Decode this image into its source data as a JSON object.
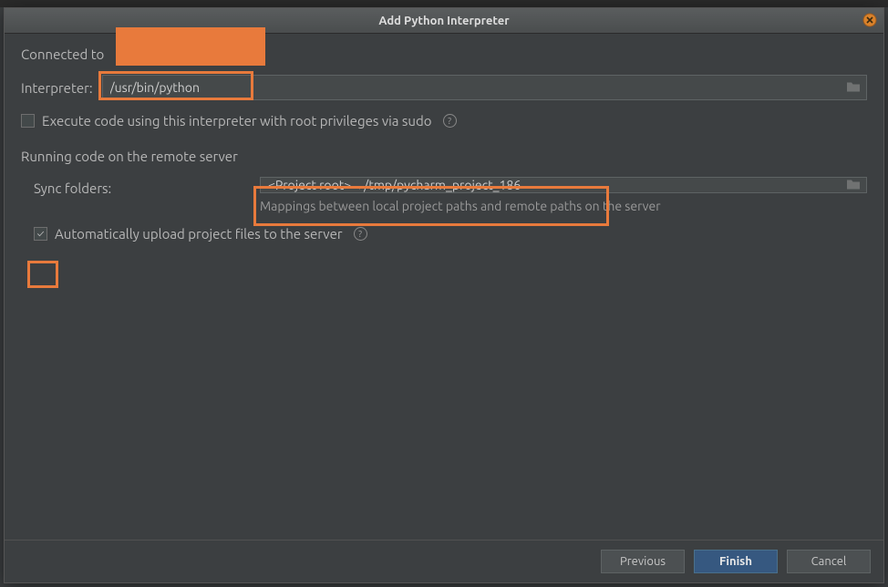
{
  "dialog_title": "Add Python Interpreter",
  "connected_label": "Connected to ",
  "interpreter_label": "Interpreter:",
  "interpreter_value": "/usr/bin/python",
  "sudo_label": "Execute code using this interpreter with root privileges via sudo",
  "section_remote": "Running code on the remote server",
  "sync_label": "Sync folders:",
  "sync_value": "<Project root>→/tmp/pycharm_project_186",
  "sync_hint": "Mappings between local project paths and remote paths on the server",
  "auto_upload_label": "Automatically upload project files to the server",
  "buttons": {
    "previous": "Previous",
    "finish": "Finish",
    "cancel": "Cancel"
  }
}
